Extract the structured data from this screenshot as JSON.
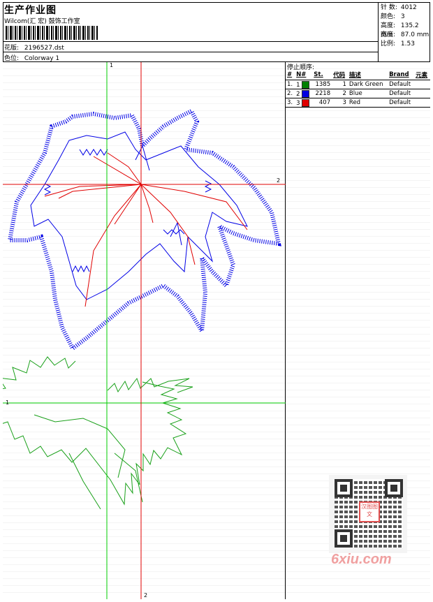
{
  "header": {
    "title": "生产作业图",
    "company": "Wilcom(汇 宏) 鼓饰工作室",
    "design_label": "花版:",
    "design_value": "2196527.dst",
    "colorway_label": "色位:",
    "colorway_value": "Colorway 1"
  },
  "stats": [
    {
      "label": "针 数:",
      "value": "4012"
    },
    {
      "label": "颜色:",
      "value": "3"
    },
    {
      "label": "高度:",
      "value": "135.2 mm"
    },
    {
      "label": "宽度:",
      "value": "87.0 mm"
    },
    {
      "label": "比例:",
      "value": "1.53"
    }
  ],
  "stop_sequence": {
    "title": "停止顺序:",
    "headers": [
      "#",
      "N#",
      "St.",
      "代码",
      "描述",
      "Brand",
      "元素"
    ],
    "rows": [
      {
        "num": "1.",
        "n": "1",
        "color": "#008000",
        "st": "1385",
        "code": "1",
        "desc": "Dark Green",
        "brand": "Default",
        "elem": ""
      },
      {
        "num": "2.",
        "n": "2",
        "color": "#0000e0",
        "st": "2218",
        "code": "2",
        "desc": "Blue",
        "brand": "Default",
        "elem": ""
      },
      {
        "num": "3.",
        "n": "3",
        "color": "#e00000",
        "st": "407",
        "code": "3",
        "desc": "Red",
        "brand": "Default",
        "elem": ""
      }
    ]
  },
  "axis_labels": {
    "green_v": "1",
    "green_h": "1",
    "red_v": "2",
    "red_h": "2"
  },
  "qr": {
    "logo_text": "汉图图文"
  },
  "watermark": "6xiu.com",
  "colors": {
    "green": "#00cc00",
    "red": "#e00000",
    "blue": "#0000e6",
    "leaf_green": "#19a019"
  }
}
